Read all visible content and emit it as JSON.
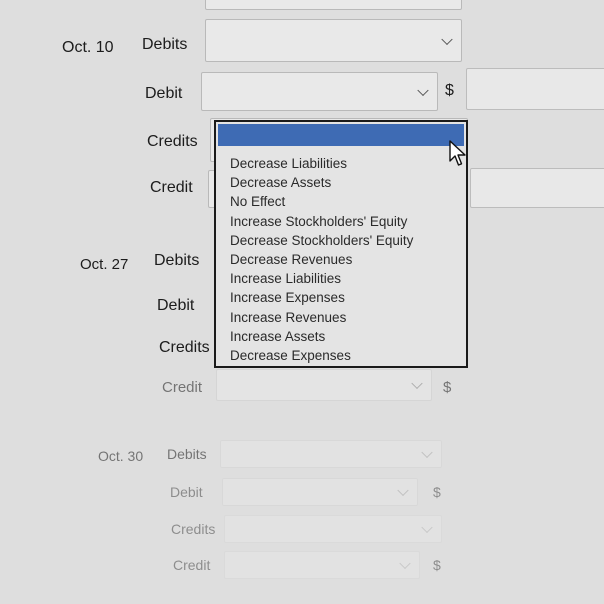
{
  "dates": {
    "oct10": "Oct. 10",
    "oct27": "Oct. 27",
    "oct30": "Oct. 30"
  },
  "labels": {
    "debits": "Debits",
    "debit": "Debit",
    "credits": "Credits",
    "credit": "Credit",
    "currency": "$"
  },
  "dropdown": {
    "selected": "",
    "options": [
      "Decrease Liabilities",
      "Decrease Assets",
      "No Effect",
      "Increase Stockholders' Equity",
      "Decrease Stockholders' Equity",
      "Decrease Revenues",
      "Increase Liabilities",
      "Increase Expenses",
      "Increase Revenues",
      "Increase Assets",
      "Decrease Expenses"
    ]
  },
  "colors": {
    "highlight": "#3e6bb4",
    "background": "#dedede"
  }
}
